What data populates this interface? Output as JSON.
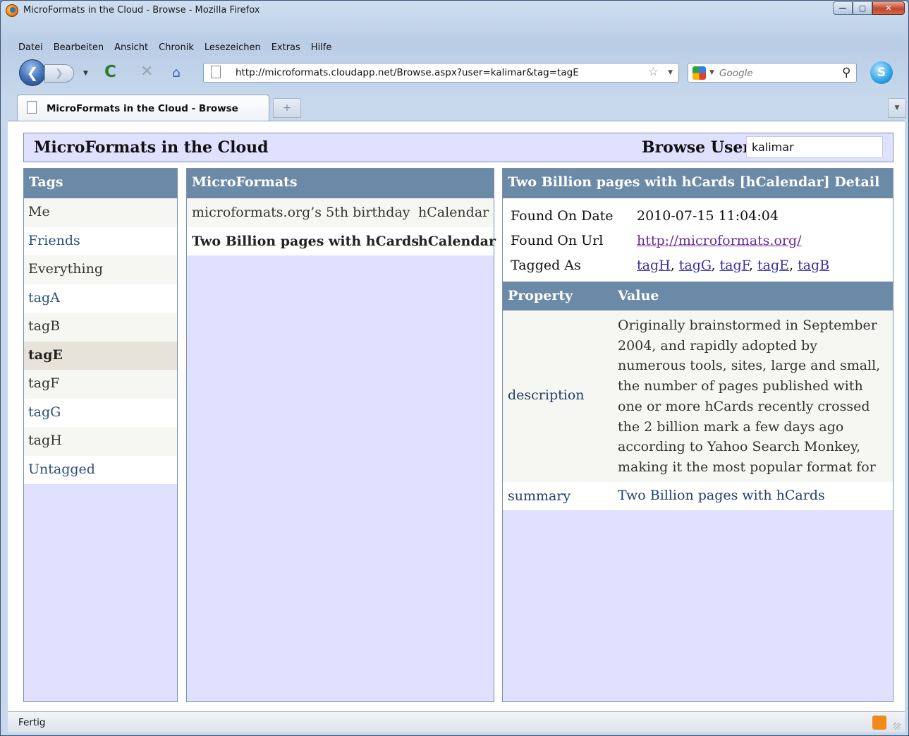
{
  "window": {
    "title": "MicroFormats in the Cloud - Browse - Mozilla Firefox"
  },
  "menu": [
    "Datei",
    "Bearbeiten",
    "Ansicht",
    "Chronik",
    "Lesezeichen",
    "Extras",
    "Hilfe"
  ],
  "nav": {
    "url": "http://microformats.cloudapp.net/Browse.aspx?user=kalimar&tag=tagE",
    "search_placeholder": "Google"
  },
  "tab": {
    "label": "MicroFormats in the Cloud - Browse"
  },
  "page": {
    "title": "MicroFormats in the Cloud",
    "browse_label": "Browse User",
    "browse_user": "kalimar"
  },
  "tags": {
    "header": "Tags",
    "items": [
      "Me",
      "Friends",
      "Everything",
      "tagA",
      "tagB",
      "tagE",
      "tagF",
      "tagG",
      "tagH",
      "Untagged"
    ],
    "selected": "tagE"
  },
  "microformats": {
    "header": "MicroFormats",
    "rows": [
      {
        "name": "microformats.org’s 5th birthday",
        "type": "hCalendar"
      },
      {
        "name": "Two Billion pages with hCards",
        "type": "hCalendar"
      }
    ]
  },
  "detail": {
    "header": "Two Billion pages with hCards [hCalendar] Detail",
    "found_on_date_label": "Found On Date",
    "found_on_date": "2010-07-15 11:04:04",
    "found_on_url_label": "Found On Url",
    "found_on_url": "http://microformats.org/",
    "tagged_as_label": "Tagged As",
    "tags": [
      "tagH",
      "tagG",
      "tagF",
      "tagE",
      "tagB"
    ],
    "property_header": "Property",
    "value_header": "Value",
    "properties": [
      {
        "name": "description",
        "value": "Originally brainstormed in September 2004, and rapidly adopted by numerous tools, sites, large and small, the number of pages published with one or more hCards recently crossed the 2 billion mark a few days ago according to Yahoo Search Monkey, making it the most popular format for people or organizations on the web:"
      },
      {
        "name": "summary",
        "value": "Two Billion pages with hCards"
      }
    ]
  },
  "status": {
    "text": "Fertig"
  }
}
